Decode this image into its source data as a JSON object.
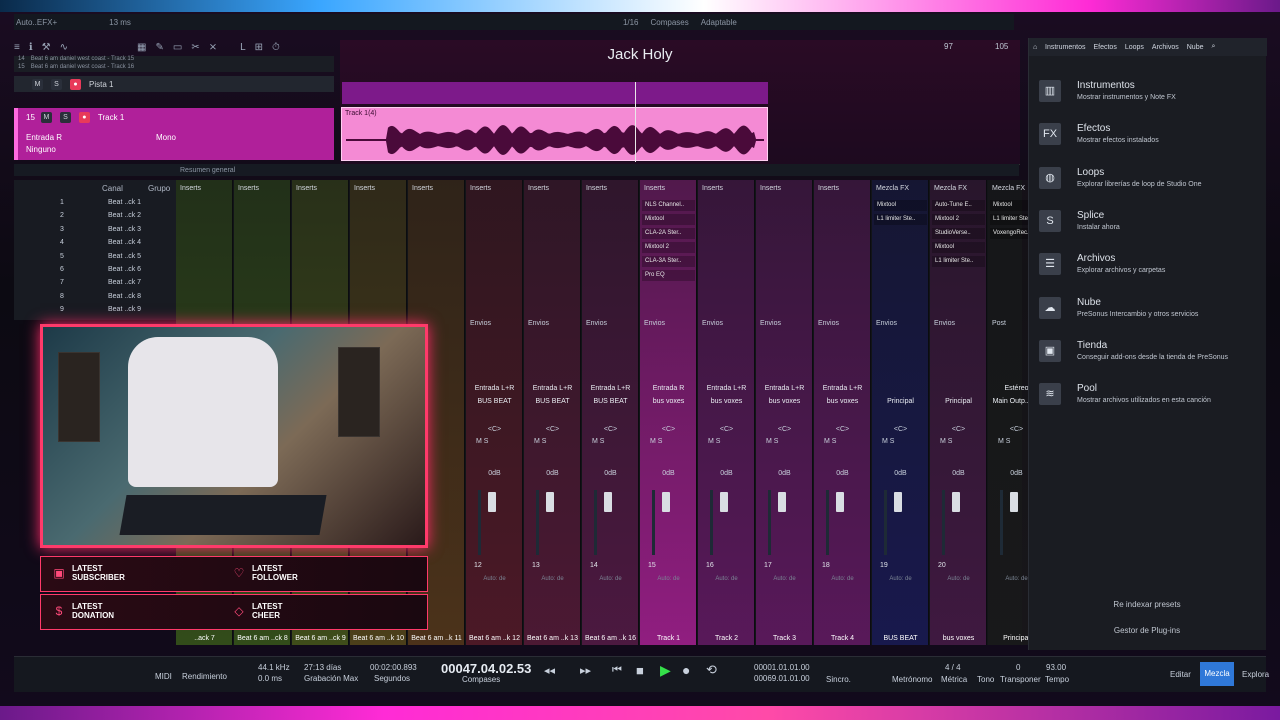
{
  "topbar": {
    "doc": "Auto..EFX+",
    "latency": "13 ms",
    "frac": "1/16",
    "compases": "Compases",
    "adaptable": "Adaptable"
  },
  "title": "Jack Holy",
  "ruler": {
    "m97": "97",
    "m105": "105"
  },
  "tracks": {
    "mini": [
      {
        "num": "14",
        "name": "Beat 6 am daniel west coast - Track 15"
      },
      {
        "num": "15",
        "name": "Beat 6 am daniel west coast - Track 16"
      }
    ],
    "pista": "Pista 1",
    "track1": {
      "num": "15",
      "name": "Track 1",
      "input": "Entrada R",
      "mode": "Mono",
      "out": "Ninguno"
    },
    "region_label": "Track 1(4)"
  },
  "summary": "Resumen general",
  "channel_list": {
    "header": "Canal",
    "group": "Grupo",
    "items": [
      "Beat ..ck 1",
      "Beat ..ck 2",
      "Beat ..ck 3",
      "Beat ..ck 4",
      "Beat ..ck 5",
      "Beat ..ck 6",
      "Beat ..ck 7",
      "Beat ..ck 8",
      "Beat ..ck 9"
    ],
    "nums": [
      "1",
      "2",
      "3",
      "4",
      "5",
      "6",
      "7",
      "8",
      "9"
    ]
  },
  "mixer": {
    "strips": [
      {
        "label": "Inserts",
        "envios": "",
        "route": "",
        "bus": "",
        "num": "",
        "name": "..ack 7",
        "color": "#3a5a1a"
      },
      {
        "label": "Inserts",
        "envios": "",
        "route": "",
        "bus": "",
        "num": "",
        "name": "Beat 6 am ..ck 8",
        "color": "#3a5a1a"
      },
      {
        "label": "Inserts",
        "envios": "",
        "route": "",
        "bus": "",
        "num": "",
        "name": "Beat 6 am ..ck 9",
        "color": "#4a5a1a"
      },
      {
        "label": "Inserts",
        "envios": "",
        "route": "",
        "bus": "",
        "num": "",
        "name": "Beat 6 am ..k 10",
        "color": "#5a4a1a"
      },
      {
        "label": "Inserts",
        "envios": "",
        "route": "",
        "bus": "",
        "num": "",
        "name": "Beat 6 am ..k 11",
        "color": "#5a3a1a"
      },
      {
        "label": "Inserts",
        "envios": "Envios",
        "route": "Entrada L+R",
        "bus": "BUS BEAT",
        "num": "12",
        "name": "Beat 6 am ..k 12",
        "color": "#5a1a2a"
      },
      {
        "label": "Inserts",
        "envios": "Envios",
        "route": "Entrada L+R",
        "bus": "BUS BEAT",
        "num": "13",
        "name": "Beat 6 am ..k 13",
        "color": "#5a1a3a"
      },
      {
        "label": "Inserts",
        "envios": "Envios",
        "route": "Entrada L+R",
        "bus": "BUS BEAT",
        "num": "14",
        "name": "Beat 6 am ..k 16",
        "color": "#5a1a4a"
      },
      {
        "label": "Inserts",
        "envios": "Envios",
        "route": "Entrada R",
        "bus": "bus voxes",
        "num": "15",
        "name": "Track 1",
        "color": "#b0209a",
        "plugins": [
          "NLS Channel..",
          "Mixtool",
          "CLA-2A Ster..",
          "Mixtool 2",
          "CLA-3A Ster..",
          "Pro EQ"
        ]
      },
      {
        "label": "Inserts",
        "envios": "Envios",
        "route": "Entrada L+R",
        "bus": "bus voxes",
        "num": "16",
        "name": "Track 2",
        "color": "#6a1a6a"
      },
      {
        "label": "Inserts",
        "envios": "Envios",
        "route": "Entrada L+R",
        "bus": "bus voxes",
        "num": "17",
        "name": "Track 3",
        "color": "#6a1a6a"
      },
      {
        "label": "Inserts",
        "envios": "Envios",
        "route": "Entrada L+R",
        "bus": "bus voxes",
        "num": "18",
        "name": "Track 4",
        "color": "#6a1a6a"
      },
      {
        "label": "Mezcla FX",
        "envios": "Envios",
        "route": "",
        "bus": "Principal",
        "num": "19",
        "name": "BUS BEAT",
        "color": "#1a1a5a",
        "plugins": [
          "Mixtool",
          "L1 limiter Ste.."
        ]
      },
      {
        "label": "Mezcla FX",
        "envios": "Envios",
        "route": "",
        "bus": "Principal",
        "num": "20",
        "name": "bus voxes",
        "color": "#4a1a4a",
        "plugins": [
          "Auto-Tune E..",
          "Mixtool 2",
          "StudioVerse..",
          "Mixtool",
          "L1 limiter Ste.."
        ]
      },
      {
        "label": "Mezcla FX",
        "envios": "Post",
        "route": "Estéreo",
        "bus": "Main Outp.. (R)",
        "num": "",
        "name": "Principal",
        "color": "#1a1a1a",
        "plugins": [
          "Mixtool",
          "L1 limiter Ste..",
          "VoxengoRec.."
        ]
      }
    ],
    "db": "0dB",
    "auto": "Auto: de",
    "pan": "<C>",
    "stereo": "Estéreo"
  },
  "alerts": [
    {
      "icon": "twitch-icon",
      "line1": "LATEST",
      "line2": "SUBSCRIBER"
    },
    {
      "icon": "heart-icon",
      "line1": "LATEST",
      "line2": "FOLLOWER"
    },
    {
      "icon": "dollar-icon",
      "line1": "LATEST",
      "line2": "DONATION"
    },
    {
      "icon": "diamond-icon",
      "line1": "LATEST",
      "line2": "CHEER"
    }
  ],
  "browser": {
    "tabs": [
      "Instrumentos",
      "Efectos",
      "Loops",
      "Archivos",
      "Nube"
    ],
    "items": [
      {
        "icon": "piano-icon",
        "glyph": "▥",
        "title": "Instrumentos",
        "desc": "Mostrar instrumentos y Note FX"
      },
      {
        "icon": "fx-icon",
        "glyph": "FX",
        "title": "Efectos",
        "desc": "Mostrar efectos instalados"
      },
      {
        "icon": "loop-icon",
        "glyph": "◍",
        "title": "Loops",
        "desc": "Explorar librerías de loop de Studio One"
      },
      {
        "icon": "splice-icon",
        "glyph": "S",
        "title": "Splice",
        "desc": "Instalar ahora"
      },
      {
        "icon": "files-icon",
        "glyph": "☰",
        "title": "Archivos",
        "desc": "Explorar archivos y carpetas"
      },
      {
        "icon": "cloud-icon",
        "glyph": "☁",
        "title": "Nube",
        "desc": "PreSonus Intercambio y otros servicios"
      },
      {
        "icon": "shop-icon",
        "glyph": "▣",
        "title": "Tienda",
        "desc": "Conseguir add-ons desde la tienda de PreSonus"
      },
      {
        "icon": "pool-icon",
        "glyph": "≋",
        "title": "Pool",
        "desc": "Mostrar archivos utilizados en esta canción"
      }
    ],
    "reindex": "Re indexar presets",
    "plugin_manager": "Gestor de Plug-ins"
  },
  "transport": {
    "midi": "MIDI",
    "render": "Rendimiento",
    "rate": "44.1 kHz",
    "rate_ms": "0.0 ms",
    "days": "27:13 días",
    "max": "Grabación Max",
    "secs": "00:02:00.893",
    "secs_label": "Segundos",
    "bars": "00047.04.02.53",
    "bars_label": "Compases",
    "l": "00001.01.01.00",
    "r": "00069.01.01.00",
    "sync": "Sincro.",
    "metro": "Metrónomo",
    "sig": "4 / 4",
    "metric": "Métrica",
    "tono": "Tono",
    "transpose": "0",
    "transpose_label": "Transponer",
    "tempo": "93.00",
    "tempo_label": "Tempo",
    "edit": "Editar",
    "mix": "Mezcla",
    "explore": "Explora"
  }
}
